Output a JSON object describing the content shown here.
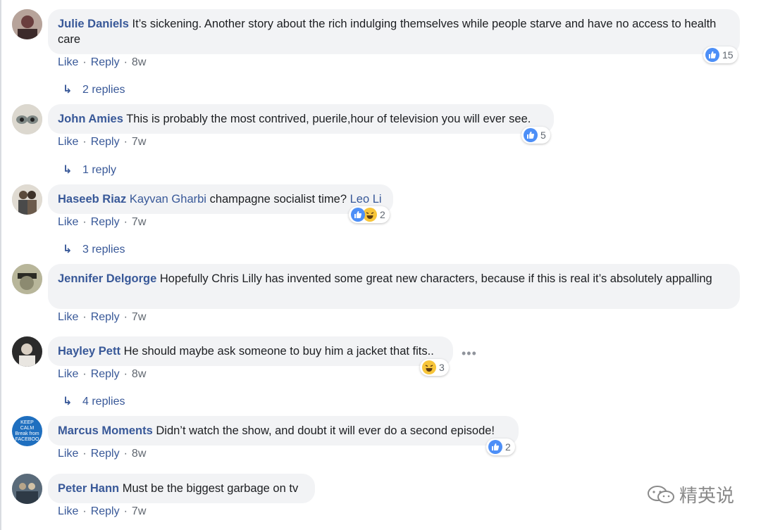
{
  "comments": [
    {
      "author": "Julie Daniels",
      "text": "It’s sickening. Another story about the rich indulging themselves while people starve and have no access to health care",
      "like": "Like",
      "reply": "Reply",
      "time": "8w",
      "reaction_count": "15",
      "replies": "2 replies",
      "avatar_colors": [
        "#6a3e3e",
        "#c8b7b0"
      ]
    },
    {
      "author": "John Amies",
      "text": "This is probably the most contrived, puerile,hour of television you will ever see.",
      "like": "Like",
      "reply": "Reply",
      "time": "7w",
      "reaction_count": "5",
      "replies": "1 reply",
      "avatar_colors": [
        "#9aa3a0",
        "#e7e3da"
      ]
    },
    {
      "author": "Haseeb Riaz",
      "mention1": "Kayvan Gharbi",
      "text": "champagne socialist time?",
      "mention2": "Leo Li",
      "like": "Like",
      "reply": "Reply",
      "time": "7w",
      "reaction_count": "2",
      "replies": "3 replies",
      "avatar_colors": [
        "#d6cfc3",
        "#5b4a3b"
      ]
    },
    {
      "author": "Jennifer Delgorge",
      "text": "Hopefully Chris Lilly has invented some great new characters, because if this is real it’s absolutely appalling",
      "like": "Like",
      "reply": "Reply",
      "time": "7w",
      "avatar_colors": [
        "#4c4f3f",
        "#b8b69a"
      ]
    },
    {
      "author": "Hayley Pett",
      "text": "He should maybe ask someone to buy him a jacket that fits..",
      "like": "Like",
      "reply": "Reply",
      "time": "8w",
      "reaction_count": "3",
      "replies": "4 replies",
      "avatar_colors": [
        "#2b2b2b",
        "#e9e6e1"
      ]
    },
    {
      "author": "Marcus Moments",
      "text": "Didn’t watch the show, and doubt it will ever do a second episode!",
      "like": "Like",
      "reply": "Reply",
      "time": "8w",
      "reaction_count": "2",
      "avatar_lines": [
        "KEEP",
        "CALM",
        "Break from",
        "FACEBOO"
      ],
      "avatar_colors": [
        "#1f6fbf",
        "#ffffff"
      ]
    },
    {
      "author": "Peter Hann",
      "text": "Must be the biggest garbage on tv",
      "like": "Like",
      "reply": "Reply",
      "time": "7w",
      "avatar_colors": [
        "#3a4a5a",
        "#b7a58a"
      ]
    }
  ],
  "watermark": "精英说",
  "colors": {
    "link": "#385898",
    "bubble": "#f2f3f5",
    "like_blue": "#4d8ff7",
    "haha_yellow": "#f7c53a",
    "meta": "#606770"
  },
  "icons": [
    "like-icon",
    "haha-icon",
    "reply-arrow-icon",
    "more-options-icon",
    "wechat-icon"
  ]
}
